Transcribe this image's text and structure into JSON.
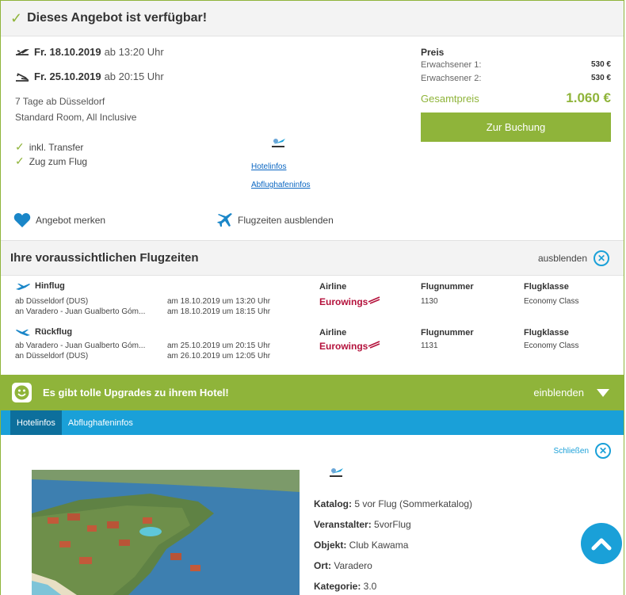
{
  "availability": {
    "title": "Dieses Angebot ist verfügbar!"
  },
  "offer": {
    "outbound": {
      "date": "Fr. 18.10.2019",
      "time": "ab 13:20 Uhr"
    },
    "return": {
      "date": "Fr. 25.10.2019",
      "time": "ab 20:15 Uhr"
    },
    "duration": "7 Tage ab Düsseldorf",
    "room": "Standard Room, All Inclusive",
    "features": [
      "inkl. Transfer",
      "Zug zum Flug"
    ],
    "links": {
      "hotel": "Hotelinfos",
      "airport": "Abflughafeninfos"
    },
    "actions": {
      "save": "Angebot merken",
      "hide_flights": "Flugzeiten ausblenden"
    }
  },
  "price": {
    "label": "Preis",
    "rows": [
      {
        "label": "Erwachsener 1:",
        "value": "530 €"
      },
      {
        "label": "Erwachsener 2:",
        "value": "530 €"
      }
    ],
    "total_label": "Gesamtpreis",
    "total_value": "1.060 €",
    "book_button": "Zur Buchung"
  },
  "flights": {
    "title": "Ihre voraussichtlichen Flugzeiten",
    "hide_label": "ausblenden",
    "headers": {
      "airline": "Airline",
      "number": "Flugnummer",
      "class": "Flugklasse"
    },
    "legs": [
      {
        "direction": "Hinflug",
        "from": "ab Düsseldorf (DUS)",
        "to": "an Varadero - Juan Gualberto Góm...",
        "dep": "am 18.10.2019 um 13:20 Uhr",
        "arr": "am 18.10.2019 um 18:15 Uhr",
        "airline": "Eurowings",
        "number": "1130",
        "class": "Economy Class"
      },
      {
        "direction": "Rückflug",
        "from": "ab Varadero - Juan Gualberto Góm...",
        "to": "an Düsseldorf (DUS)",
        "dep": "am 25.10.2019 um 20:15 Uhr",
        "arr": "am 26.10.2019 um 12:05 Uhr",
        "airline": "Eurowings",
        "number": "1131",
        "class": "Economy Class"
      }
    ]
  },
  "upgrades": {
    "title": "Es gibt tolle Upgrades zu ihrem Hotel!",
    "toggle": "einblenden"
  },
  "tabs": [
    "Hotelinfos",
    "Abflughafeninfos"
  ],
  "hotel": {
    "close_label": "Schließen",
    "details": [
      {
        "key": "Katalog:",
        "value": " 5 vor Flug (Sommerkatalog)"
      },
      {
        "key": "Veranstalter:",
        "value": " 5vorFlug"
      },
      {
        "key": "Objekt:",
        "value": " Club Kawama"
      },
      {
        "key": "Ort:",
        "value": " Varadero"
      },
      {
        "key": "Kategorie:",
        "value": " 3.0"
      }
    ]
  },
  "colors": {
    "brand_green": "#8fb43a",
    "brand_blue": "#1aa0d8",
    "eurowings": "#b4123c"
  }
}
